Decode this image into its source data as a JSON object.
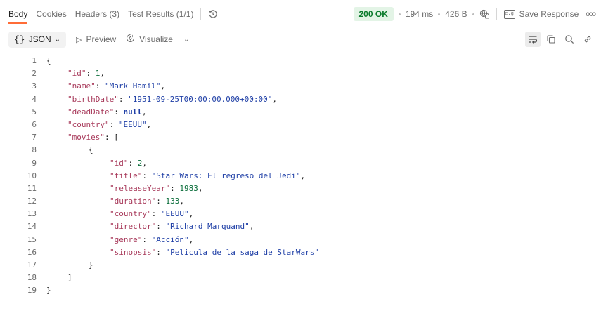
{
  "tabs": [
    {
      "label": "Body",
      "active": true
    },
    {
      "label": "Cookies",
      "active": false
    },
    {
      "label": "Headers (3)",
      "active": false
    },
    {
      "label": "Test Results (1/1)",
      "active": false
    }
  ],
  "history_icon": "history-icon",
  "status": {
    "code": "200 OK",
    "time": "194 ms",
    "size": "426 B",
    "globe_icon": "globe-lock-icon"
  },
  "save_response": "Save Response",
  "more_icon": "ooo",
  "toolbar": {
    "format_label": "JSON",
    "format_braces": "{}",
    "preview_label": "Preview",
    "visualize_label": "Visualize",
    "icons": [
      "wrap-lines-icon",
      "copy-icon",
      "search-icon",
      "link-icon"
    ]
  },
  "code_lines": [
    {
      "n": "1",
      "indent": 0,
      "parts": [
        {
          "t": "p",
          "v": "{"
        }
      ]
    },
    {
      "n": "2",
      "indent": 1,
      "parts": [
        {
          "t": "k",
          "v": "\"id\""
        },
        {
          "t": "p",
          "v": ": "
        },
        {
          "t": "n",
          "v": "1"
        },
        {
          "t": "p",
          "v": ","
        }
      ]
    },
    {
      "n": "3",
      "indent": 1,
      "parts": [
        {
          "t": "k",
          "v": "\"name\""
        },
        {
          "t": "p",
          "v": ": "
        },
        {
          "t": "s",
          "v": "\"Mark Hamil\""
        },
        {
          "t": "p",
          "v": ","
        }
      ]
    },
    {
      "n": "4",
      "indent": 1,
      "parts": [
        {
          "t": "k",
          "v": "\"birthDate\""
        },
        {
          "t": "p",
          "v": ": "
        },
        {
          "t": "s",
          "v": "\"1951-09-25T00:00:00.000+00:00\""
        },
        {
          "t": "p",
          "v": ","
        }
      ]
    },
    {
      "n": "5",
      "indent": 1,
      "parts": [
        {
          "t": "k",
          "v": "\"deadDate\""
        },
        {
          "t": "p",
          "v": ": "
        },
        {
          "t": "kw",
          "v": "null"
        },
        {
          "t": "p",
          "v": ","
        }
      ]
    },
    {
      "n": "6",
      "indent": 1,
      "parts": [
        {
          "t": "k",
          "v": "\"country\""
        },
        {
          "t": "p",
          "v": ": "
        },
        {
          "t": "s",
          "v": "\"EEUU\""
        },
        {
          "t": "p",
          "v": ","
        }
      ]
    },
    {
      "n": "7",
      "indent": 1,
      "parts": [
        {
          "t": "k",
          "v": "\"movies\""
        },
        {
          "t": "p",
          "v": ": ["
        }
      ]
    },
    {
      "n": "8",
      "indent": 2,
      "parts": [
        {
          "t": "p",
          "v": "{"
        }
      ]
    },
    {
      "n": "9",
      "indent": 3,
      "parts": [
        {
          "t": "k",
          "v": "\"id\""
        },
        {
          "t": "p",
          "v": ": "
        },
        {
          "t": "n",
          "v": "2"
        },
        {
          "t": "p",
          "v": ","
        }
      ]
    },
    {
      "n": "10",
      "indent": 3,
      "parts": [
        {
          "t": "k",
          "v": "\"title\""
        },
        {
          "t": "p",
          "v": ": "
        },
        {
          "t": "s",
          "v": "\"Star Wars: El regreso del Jedi\""
        },
        {
          "t": "p",
          "v": ","
        }
      ]
    },
    {
      "n": "11",
      "indent": 3,
      "parts": [
        {
          "t": "k",
          "v": "\"releaseYear\""
        },
        {
          "t": "p",
          "v": ": "
        },
        {
          "t": "n",
          "v": "1983"
        },
        {
          "t": "p",
          "v": ","
        }
      ]
    },
    {
      "n": "12",
      "indent": 3,
      "parts": [
        {
          "t": "k",
          "v": "\"duration\""
        },
        {
          "t": "p",
          "v": ": "
        },
        {
          "t": "n",
          "v": "133"
        },
        {
          "t": "p",
          "v": ","
        }
      ]
    },
    {
      "n": "13",
      "indent": 3,
      "parts": [
        {
          "t": "k",
          "v": "\"country\""
        },
        {
          "t": "p",
          "v": ": "
        },
        {
          "t": "s",
          "v": "\"EEUU\""
        },
        {
          "t": "p",
          "v": ","
        }
      ]
    },
    {
      "n": "14",
      "indent": 3,
      "parts": [
        {
          "t": "k",
          "v": "\"director\""
        },
        {
          "t": "p",
          "v": ": "
        },
        {
          "t": "s",
          "v": "\"Richard Marquand\""
        },
        {
          "t": "p",
          "v": ","
        }
      ]
    },
    {
      "n": "15",
      "indent": 3,
      "parts": [
        {
          "t": "k",
          "v": "\"genre\""
        },
        {
          "t": "p",
          "v": ": "
        },
        {
          "t": "s",
          "v": "\"Acción\""
        },
        {
          "t": "p",
          "v": ","
        }
      ]
    },
    {
      "n": "16",
      "indent": 3,
      "parts": [
        {
          "t": "k",
          "v": "\"sinopsis\""
        },
        {
          "t": "p",
          "v": ": "
        },
        {
          "t": "s",
          "v": "\"Pelicula de la saga de StarWars\""
        }
      ]
    },
    {
      "n": "17",
      "indent": 2,
      "parts": [
        {
          "t": "p",
          "v": "}"
        }
      ]
    },
    {
      "n": "18",
      "indent": 1,
      "parts": [
        {
          "t": "p",
          "v": "]"
        }
      ]
    },
    {
      "n": "19",
      "indent": 0,
      "parts": [
        {
          "t": "p",
          "v": "}"
        }
      ]
    }
  ],
  "colors": {
    "key": "#a83a5b",
    "string": "#1f3fa6",
    "number": "#0b6e3b",
    "status_bg": "#e3f4e6",
    "status_text": "#0a7a2b",
    "active_tab_underline": "#ff6c37"
  }
}
